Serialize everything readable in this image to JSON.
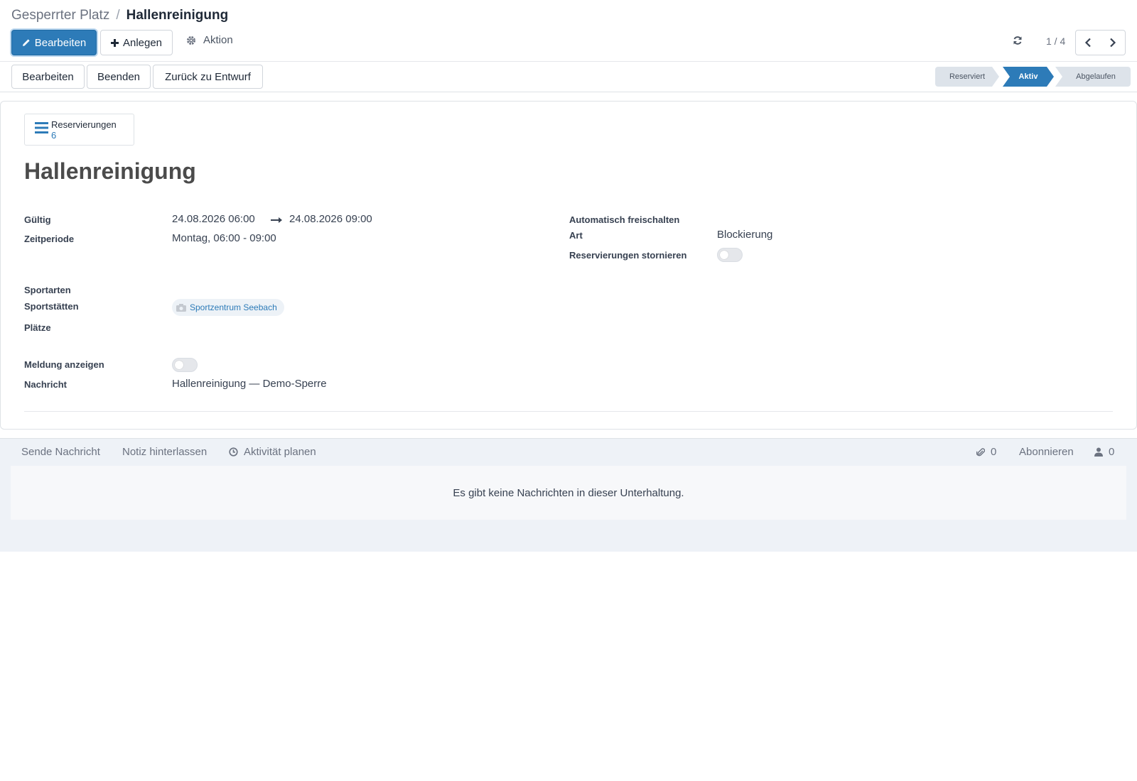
{
  "breadcrumb": {
    "parent": "Gesperrter Platz",
    "separator": "/",
    "current": "Hallenreinigung"
  },
  "toolbar": {
    "edit_label": "Bearbeiten",
    "create_label": "Anlegen",
    "action_label": "Aktion"
  },
  "pager": {
    "value": "1 / 4"
  },
  "status_buttons": {
    "edit": "Bearbeiten",
    "end": "Beenden",
    "back_to_draft": "Zurück zu Entwurf"
  },
  "statusbar": {
    "stages": [
      "Reserviert",
      "Aktiv",
      "Abgelaufen"
    ],
    "active": "Aktiv"
  },
  "smart_button": {
    "label": "Reservierungen",
    "value": "6"
  },
  "record": {
    "title": "Hallenreinigung",
    "fields": {
      "gueltig_label": "Gültig",
      "gueltig_from": "24.08.2026 06:00",
      "gueltig_to": "24.08.2026 09:00",
      "zeitperiode_label": "Zeitperiode",
      "zeitperiode": "Montag, 06:00 - 09:00",
      "auto_label": "Automatisch freischalten",
      "art_label": "Art",
      "art": "Blockierung",
      "storno_label": "Reservierungen stornieren",
      "storno": false,
      "sportarten_label": "Sportarten",
      "sportstaetten_label": "Sportstätten",
      "sportstaetten": "Sportzentrum Seebach",
      "plaetze_label": "Plätze",
      "meldung_label": "Meldung anzeigen",
      "meldung": false,
      "nachricht_label": "Nachricht",
      "nachricht": "Hallenreinigung — Demo-Sperre"
    }
  },
  "chatter": {
    "send_message": "Sende Nachricht",
    "log_note": "Notiz hinterlassen",
    "schedule_activity": "Aktivität planen",
    "attachments": "0",
    "follow": "Abonnieren",
    "followers": "0",
    "empty": "Es gibt keine Nachrichten in dieser Unterhaltung."
  },
  "colors": {
    "primary": "#2d7bb8",
    "status_inactive": "#dde3ea",
    "chatter_bg": "#eef2f7"
  }
}
